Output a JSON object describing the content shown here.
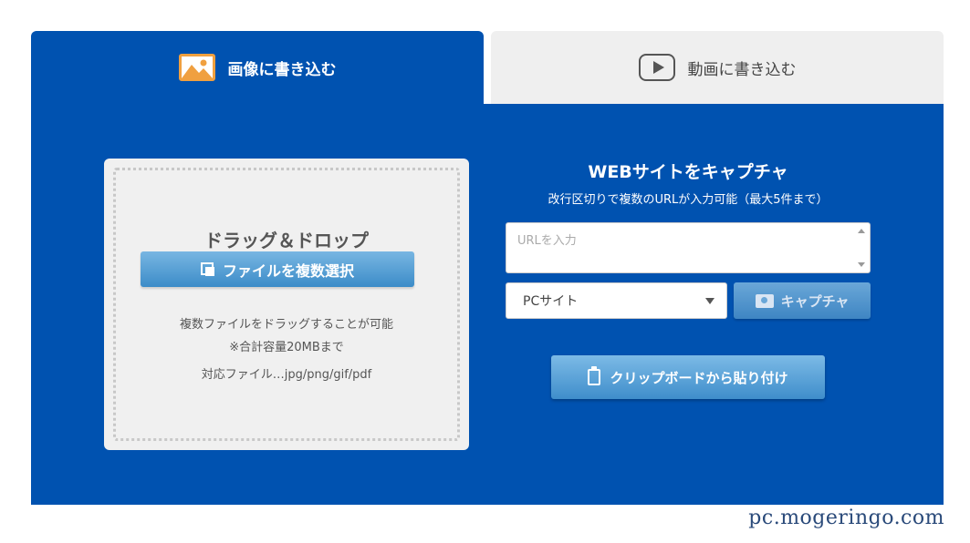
{
  "tabs": {
    "image": {
      "label": "画像に書き込む",
      "icon": "image-icon"
    },
    "video": {
      "label": "動画に書き込む",
      "icon": "play-icon"
    }
  },
  "dropzone": {
    "title": "ドラッグ＆ドロップ",
    "select_button": "ファイルを複数選択",
    "note1": "複数ファイルをドラッグすることが可能",
    "note2": "※合計容量20MBまで",
    "note3": "対応ファイル…jpg/png/gif/pdf"
  },
  "capture": {
    "title": "WEBサイトをキャプチャ",
    "subtitle": "改行区切りで複数のURLが入力可能（最大5件まで）",
    "url_placeholder": "URLを入力",
    "url_value": "",
    "select_value": "PCサイト",
    "capture_button": "キャプチャ",
    "clipboard_button": "クリップボードから貼り付け"
  },
  "watermark": "pc.mogeringo.com",
  "colors": {
    "primary_blue": "#0052b0",
    "button_blue": "#3c8cc8",
    "tab_inactive": "#efefef",
    "image_icon_orange": "#f0a040"
  }
}
